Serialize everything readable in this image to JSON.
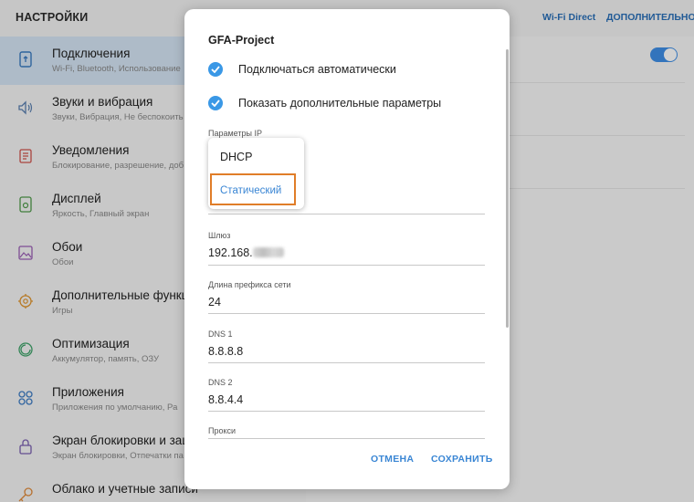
{
  "topbar": {
    "title": "НАСТРОЙКИ",
    "wifi_direct": "Wi-Fi Direct",
    "more": "ДОПОЛНИТЕЛЬНО"
  },
  "sidebar": {
    "items": [
      {
        "title": "Подключения",
        "subtitle": "Wi-Fi, Bluetooth, Использование",
        "icon": "connections-icon",
        "active": true
      },
      {
        "title": "Звуки и вибрация",
        "subtitle": "Звуки, Вибрация, Не беспокоить",
        "icon": "sound-icon"
      },
      {
        "title": "Уведомления",
        "subtitle": "Блокирование, разрешение, доб",
        "icon": "notifications-icon"
      },
      {
        "title": "Дисплей",
        "subtitle": "Яркость, Главный экран",
        "icon": "display-icon"
      },
      {
        "title": "Обои",
        "subtitle": "Обои",
        "icon": "wallpaper-icon"
      },
      {
        "title": "Дополнительные функц",
        "subtitle": "Игры",
        "icon": "advanced-features-icon"
      },
      {
        "title": "Оптимизация",
        "subtitle": "Аккумулятор, память, ОЗУ",
        "icon": "optimization-icon"
      },
      {
        "title": "Приложения",
        "subtitle": "Приложения по умолчанию, Ра",
        "icon": "apps-icon"
      },
      {
        "title": "Экран блокировки и защ",
        "subtitle": "Экран блокировки, Отпечатки па",
        "icon": "lock-icon"
      },
      {
        "title": "Облако и учетные записи",
        "subtitle": "",
        "icon": "key-icon"
      }
    ]
  },
  "dialog": {
    "title": "GFA-Project",
    "auto_connect": "Подключаться автоматически",
    "show_advanced": "Показать дополнительные параметры",
    "ip_label": "Параметры IP",
    "ip_options": [
      "DHCP",
      "Статический"
    ],
    "gateway_label": "Шлюз",
    "gateway_value": "192.168.",
    "prefix_label": "Длина префикса сети",
    "prefix_value": "24",
    "dns1_label": "DNS 1",
    "dns1_value": "8.8.8.8",
    "dns2_label": "DNS 2",
    "dns2_value": "8.8.4.4",
    "proxy_label": "Прокси",
    "cancel": "ОТМЕНА",
    "save": "СОХРАНИТЬ"
  },
  "colors": {
    "accent": "#3a86d4",
    "checkbox": "#3a98e6",
    "highlight": "#e07d28",
    "active_item": "#d5e5f4"
  }
}
